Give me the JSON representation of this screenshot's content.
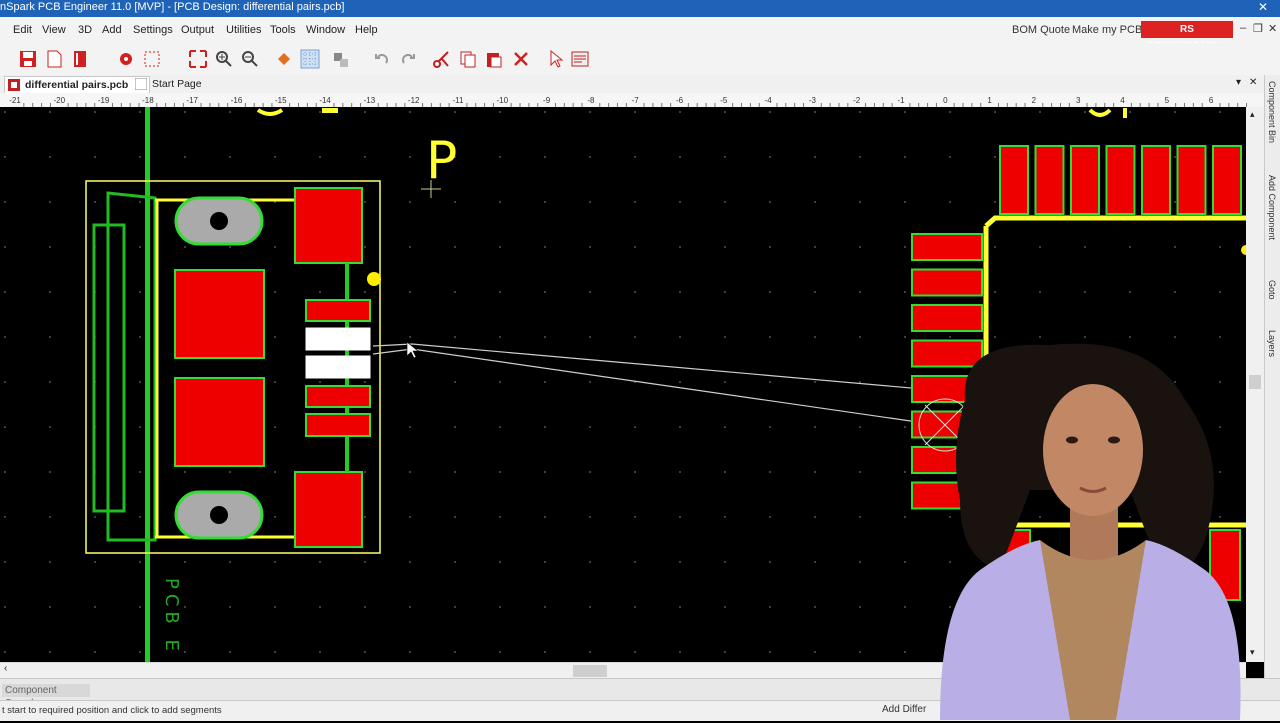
{
  "window": {
    "title": "nSpark PCB Engineer 11.0  [MVP] - [PCB Design: differential pairs.pcb]",
    "close_glyph": "✕"
  },
  "menu": {
    "items": [
      "Edit",
      "View",
      "3D",
      "Add",
      "Settings",
      "Output",
      "Utilities",
      "Tools",
      "Window",
      "Help"
    ],
    "bom_quote": "BOM Quote",
    "make_my_pcb": "Make my PCB",
    "logo": "RS DESIGNSPARK+",
    "minimize": "–",
    "restore": "❐",
    "close": "✕"
  },
  "toolbar": {
    "icons": [
      "save-icon",
      "new-icon",
      "book-icon",
      "design-rules-icon",
      "grid-icon",
      "zoom-fit-icon",
      "zoom-in-icon",
      "zoom-out-icon",
      "fill-icon",
      "grid-toggle-icon",
      "pan-icon",
      "undo-icon",
      "redo-icon",
      "cut-icon",
      "copy-icon",
      "paste-icon",
      "delete-icon",
      "select-icon",
      "properties-icon"
    ]
  },
  "tabs": [
    {
      "label": "differential pairs.pcb",
      "active": true
    },
    {
      "label": "Start Page",
      "active": false
    }
  ],
  "tabbar_menu": "▾",
  "tabbar_close": "✕",
  "ruler": {
    "ticks": [
      "-21",
      "-20",
      "-19",
      "-18",
      "-17",
      "-16",
      "-15",
      "-14",
      "-13",
      "-12",
      "-11",
      "-10",
      "-9",
      "-8",
      "-7",
      "-6",
      "-5",
      "-4",
      "-3",
      "-2",
      "-1",
      "0",
      "1",
      "2",
      "3",
      "4",
      "5",
      "6"
    ]
  },
  "side_panel": [
    "Component Bin",
    "Add Component",
    "Goto",
    "Layers"
  ],
  "canvas": {
    "ref_label_p": "P",
    "silk_text": "PCB E",
    "colors": {
      "background": "#000000",
      "pad": "#ee0000",
      "pad_outline": "#33dd33",
      "silkscreen": "#ffff33",
      "track": "#22cc22",
      "selected": "#ffffff",
      "ratsnest": "#cfcfcf"
    }
  },
  "component_search": "Component Search",
  "status": {
    "hint": "t start to required position and click to add segments",
    "right": "Add Differ"
  },
  "overlay": {
    "type": "presenter-video"
  }
}
